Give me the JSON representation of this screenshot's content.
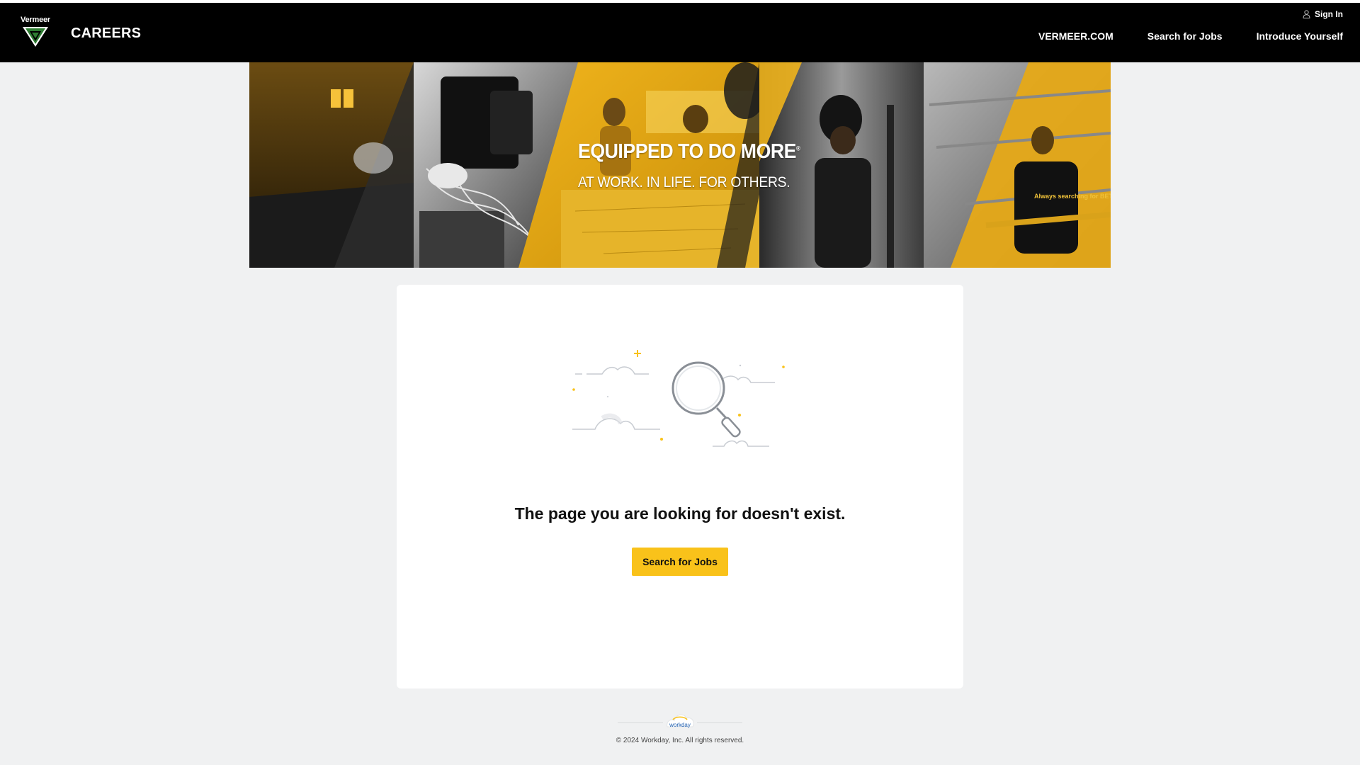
{
  "header": {
    "logo_text": "Vermeer",
    "site_title": "CAREERS",
    "sign_in": "Sign In",
    "nav": [
      "VERMEER.COM",
      "Search for Jobs",
      "Introduce Yourself"
    ]
  },
  "hero": {
    "title": "EQUIPPED TO DO MORE",
    "registered_mark": "®",
    "subtitle": "AT WORK. IN LIFE. FOR OTHERS.",
    "shirt_text": "Always searching for BETTER WAY"
  },
  "main": {
    "message": "The page you are looking for doesn't exist.",
    "cta_label": "Search for Jobs"
  },
  "footer": {
    "brand": "workday",
    "copyright": "© 2024 Workday, Inc. All rights reserved."
  },
  "colors": {
    "accent": "#f9c21a",
    "header_bg": "#000000",
    "page_bg": "#f0f1f2",
    "card_bg": "#ffffff",
    "logo_green": "#2e7d32"
  }
}
